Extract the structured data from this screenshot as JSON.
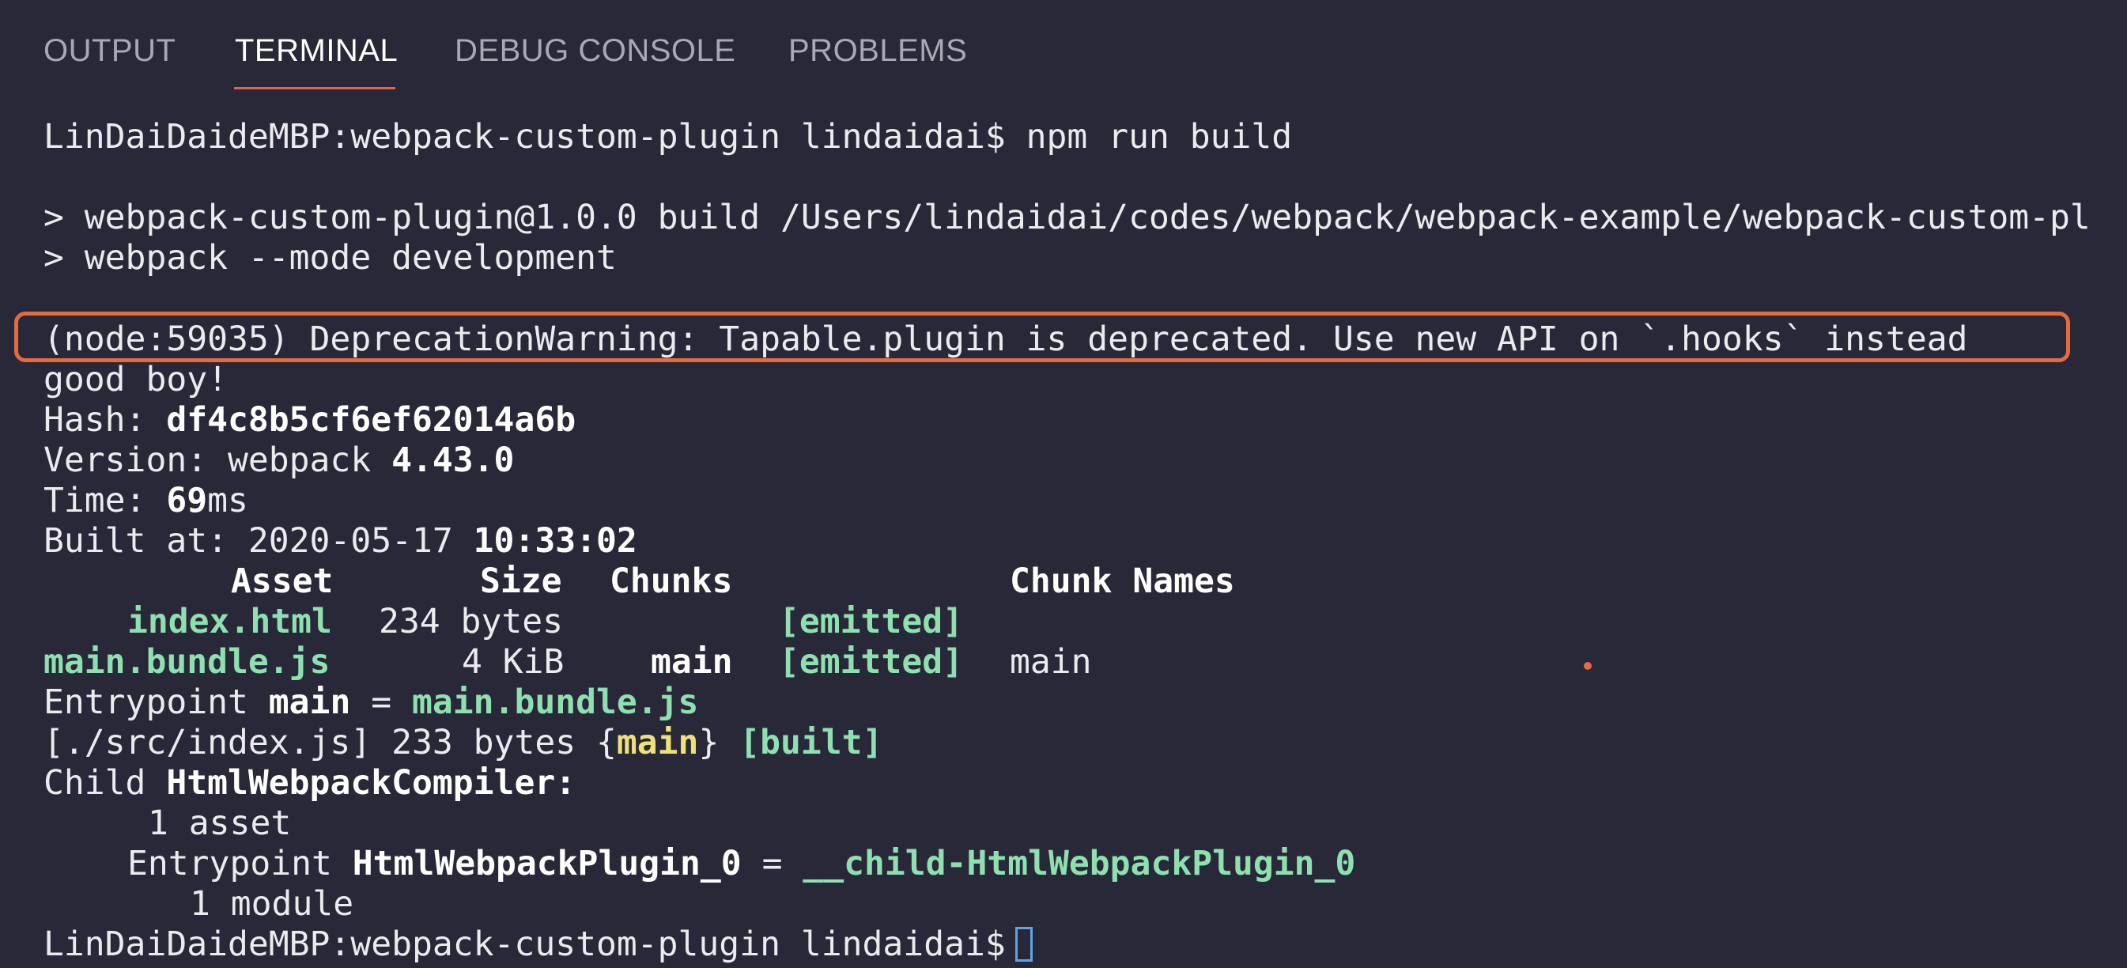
{
  "tabs": [
    "OUTPUT",
    "TERMINAL",
    "DEBUG CONSOLE",
    "PROBLEMS"
  ],
  "active_tab": "TERMINAL",
  "terminal": {
    "prompt": "LinDaiDaideMBP:webpack-custom-plugin lindaidai$",
    "command": "npm run build",
    "script_line_1": "> webpack-custom-plugin@1.0.0 build /Users/lindaidai/codes/webpack/webpack-example/webpack-custom-pl",
    "script_line_2": "> webpack --mode development",
    "warning": "(node:59035) DeprecationWarning: Tapable.plugin is deprecated. Use new API on `.hooks` instead",
    "plugin_output": "good boy!",
    "hash_label": "Hash:",
    "hash_value": "df4c8b5cf6ef62014a6b",
    "version_label": "Version: webpack",
    "version_value": "4.43.0",
    "time_label": "Time:",
    "time_value": "69",
    "time_unit": "ms",
    "built_label": "Built at: 2020-05-17",
    "built_time": "10:33:02",
    "asset_table": {
      "headers": [
        "Asset",
        "Size",
        "Chunks",
        "Chunk Names"
      ],
      "rows": [
        {
          "asset": "index.html",
          "size": "234 bytes",
          "chunks": "",
          "status": "[emitted]",
          "chunk_names": ""
        },
        {
          "asset": "main.bundle.js",
          "size": "4 KiB",
          "chunks": "main",
          "status": "[emitted]",
          "chunk_names": "main"
        }
      ]
    },
    "entrypoint_label": "Entrypoint",
    "entrypoint_name": "main",
    "entrypoint_eq": "=",
    "entrypoint_file": "main.bundle.js",
    "module_path": "[./src/index.js]",
    "module_size": "233 bytes",
    "module_chunk": "main",
    "module_status": "[built]",
    "child_label": "Child",
    "child_name": "HtmlWebpackCompiler:",
    "child_assets": "1 asset",
    "child_entry_label": "Entrypoint",
    "child_entry_name": "HtmlWebpackPlugin_0",
    "child_entry_eq": "=",
    "child_entry_file": "__child-HtmlWebpackPlugin_0",
    "child_modules": "1 module"
  },
  "colors": {
    "background": "#282838",
    "highlight_border": "#e56a3f",
    "asset_green": "#8ee0b0",
    "chunk_yellow": "#f0e07a",
    "cursor_blue": "#5aa7e8"
  }
}
